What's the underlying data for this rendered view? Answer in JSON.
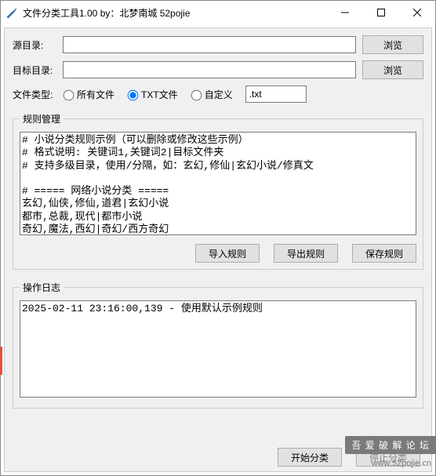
{
  "window": {
    "title": "文件分类工具1.00  by：北梦南城 52pojie"
  },
  "source": {
    "label": "源目录:",
    "value": "",
    "browse": "浏览"
  },
  "target": {
    "label": "目标目录:",
    "value": "",
    "browse": "浏览"
  },
  "filetype": {
    "label": "文件类型:",
    "opt_all": "所有文件",
    "opt_txt": "TXT文件",
    "opt_custom": "自定义",
    "ext_value": ".txt",
    "selected": "txt"
  },
  "rules": {
    "legend": "规则管理",
    "text": "# 小说分类规则示例（可以删除或修改这些示例）\n# 格式说明: 关键词1,关键词2|目标文件夹\n# 支持多级目录，使用/分隔，如：玄幻,修仙|玄幻小说/修真文\n\n# ===== 网络小说分类 =====\n玄幻,仙侠,修仙,道君|玄幻小说\n都市,总裁,现代|都市小说\n奇幻,魔法,西幻|奇幻/西方奇幻\n科幻,未来,星际|科幻小说\n历史,穿越|历史小说",
    "import_btn": "导入规则",
    "export_btn": "导出规则",
    "save_btn": "保存规则"
  },
  "log": {
    "legend": "操作日志",
    "text": "2025-02-11 23:16:00,139 - 使用默认示例规则\n"
  },
  "actions": {
    "start": "开始分类",
    "stop": "停止分类"
  },
  "watermark": {
    "main": "吾 爱 破 解 论 坛",
    "sub": "www.52pojie.cn"
  }
}
